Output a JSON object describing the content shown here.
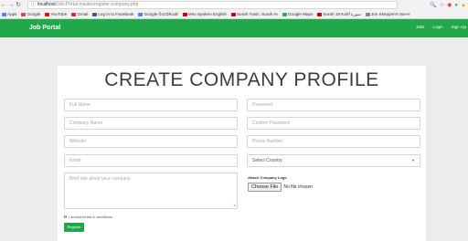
{
  "browser": {
    "url_host": "localhost",
    "url_path": "/Job-Portal-master/register-company.php",
    "bookmarks": [
      {
        "label": "Apps",
        "color": "#4285f4"
      },
      {
        "label": "Google",
        "color": "#ea4335"
      },
      {
        "label": "YouTube",
        "color": "#ff0000"
      },
      {
        "label": "Gmail",
        "color": "#d93025"
      },
      {
        "label": "Log in to Facebook",
        "color": "#3b5998"
      },
      {
        "label": "Google මාර්ගයෙන්",
        "color": "#4285f4"
      },
      {
        "label": "Veto Spoken English",
        "color": "#cc0000"
      },
      {
        "label": "Surah Yasin, Surah Ar",
        "color": "#cc0000"
      },
      {
        "label": "Google Maps",
        "color": "#34a853"
      },
      {
        "label": "Surah 18 Kahf سورة",
        "color": "#cc0000"
      },
      {
        "label": "Jon Skeppen's Sie-H",
        "color": "#888888"
      }
    ]
  },
  "navbar": {
    "brand": "Job Portal",
    "links": [
      "Jobs",
      "Login",
      "Sign Up"
    ]
  },
  "form": {
    "title": "CREATE COMPANY PROFILE",
    "full_name": "Full Name",
    "company_name": "Company Name",
    "website": "Website",
    "email": "Email",
    "about": "Brief info about your company",
    "password": "Password",
    "confirm_password": "Confirm Password",
    "phone": "Phone Number",
    "country": "Select Country",
    "attach_label": "Attach Company Logo",
    "choose_file": "Choose File",
    "no_file": "No file chosen",
    "terms": "I accept terms & conditions",
    "register": "Register"
  },
  "colors": {
    "accent": "#21a84a",
    "page_bg": "#ececec"
  }
}
